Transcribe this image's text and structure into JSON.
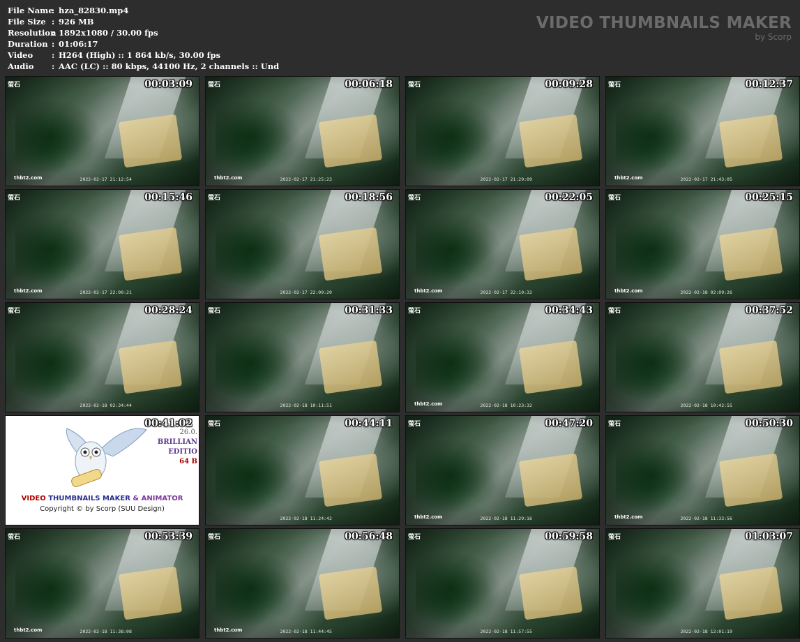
{
  "file_info": [
    {
      "key": "File Name",
      "sep": ":",
      "value": "hza_82830.mp4"
    },
    {
      "key": "File Size",
      "sep": ":",
      "value": "926 MB"
    },
    {
      "key": "Resolution",
      "sep": ":",
      "value": "1892x1080 / 30.00 fps"
    },
    {
      "key": "Duration",
      "sep": ":",
      "value": "01:06:17"
    },
    {
      "key": "Video",
      "sep": ":",
      "value": "H264 (High) :: 1 864 kb/s, 30.00 fps"
    },
    {
      "key": "Audio",
      "sep": ":",
      "value": "AAC (LC) :: 80 kbps, 44100 Hz, 2 channels :: Und"
    }
  ],
  "brand": {
    "title": "VIDEO THUMBNAILS MAKER",
    "subtitle": "by Scorp"
  },
  "thumbs": [
    {
      "time": "00:03:09",
      "logo": "萤石",
      "site": "thbt2.com",
      "date": "2022-02-17 21:12:54"
    },
    {
      "time": "00:06:18",
      "logo": "萤石",
      "site": "thbt2.com",
      "date": "2022-02-17 21:25:23"
    },
    {
      "time": "00:09:28",
      "logo": "萤石",
      "site": "",
      "date": "2022-02-17 21:29:09"
    },
    {
      "time": "00:12:37",
      "logo": "萤石",
      "site": "thbt2.com",
      "date": "2022-02-17 21:43:05"
    },
    {
      "time": "00:15:46",
      "logo": "萤石",
      "site": "thbt2.com",
      "date": "2022-02-17 22:00:21"
    },
    {
      "time": "00:18:56",
      "logo": "萤石",
      "site": "",
      "date": "2022-02-17 22:09:20"
    },
    {
      "time": "00:22:05",
      "logo": "萤石",
      "site": "thbt2.com",
      "date": "2022-02-17 22:10:32"
    },
    {
      "time": "00:25:15",
      "logo": "萤石",
      "site": "thbt2.com",
      "date": "2022-02-18 02:09:26"
    },
    {
      "time": "00:28:24",
      "logo": "萤石",
      "site": "",
      "date": "2022-02-18 02:34:44"
    },
    {
      "time": "00:31:33",
      "logo": "萤石",
      "site": "",
      "date": "2022-02-18 10:11:51"
    },
    {
      "time": "00:34:43",
      "logo": "萤石",
      "site": "thbt2.com",
      "date": "2022-02-18 10:23:32"
    },
    {
      "time": "00:37:52",
      "logo": "萤石",
      "site": "",
      "date": "2022-02-18 10:42:55"
    },
    {
      "time": "00:41:02",
      "promo": true
    },
    {
      "time": "00:44:11",
      "logo": "萤石",
      "site": "",
      "date": "2022-02-18 11:24:42"
    },
    {
      "time": "00:47:20",
      "logo": "萤石",
      "site": "thbt2.com",
      "date": "2022-02-18 11:29:16"
    },
    {
      "time": "00:50:30",
      "logo": "萤石",
      "site": "thbt2.com",
      "date": "2022-02-18 11:33:56"
    },
    {
      "time": "00:53:39",
      "logo": "萤石",
      "site": "thbt2.com",
      "date": "2022-02-18 11:38:08"
    },
    {
      "time": "00:56:48",
      "logo": "萤石",
      "site": "thbt2.com",
      "date": "2022-02-18 11:44:45"
    },
    {
      "time": "00:59:58",
      "logo": "萤石",
      "site": "",
      "date": "2022-02-18 11:57:55"
    },
    {
      "time": "01:03:07",
      "logo": "萤石",
      "site": "",
      "date": "2022-02-18 12:01:19"
    }
  ],
  "promo": {
    "version": "26.0.",
    "edition_1": "BRILLIAN",
    "edition_2": "EDITIO",
    "bits": "64 B",
    "title_1": "VIDEO",
    "title_2": "THUMBNAILS MAKER",
    "title_3": "& ANIMATOR",
    "copyright": "Copyright © by Scorp (SUU Design)"
  }
}
